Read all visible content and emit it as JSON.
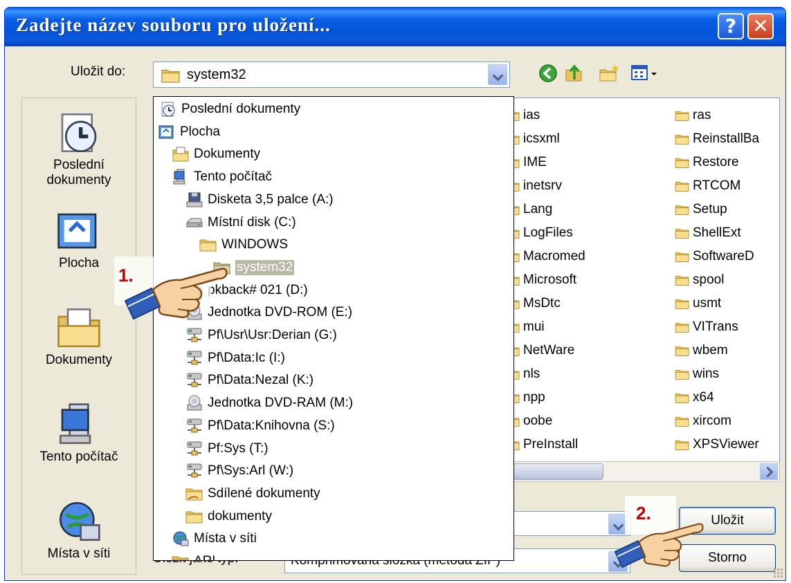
{
  "window": {
    "title": "Zadejte název souboru pro uložení...",
    "help_symbol": "?",
    "close_symbol": "✕"
  },
  "save_in": {
    "label": "Uložit do:",
    "value": "system32"
  },
  "toolbar": {
    "icons": [
      "back-icon",
      "up-folder-icon",
      "new-folder-icon",
      "views-menu-icon"
    ]
  },
  "places": [
    {
      "label": "Poslední\ndokumenty",
      "icon": "recent-documents-icon"
    },
    {
      "label": "Plocha",
      "icon": "desktop-icon"
    },
    {
      "label": "Dokumenty",
      "icon": "my-documents-icon"
    },
    {
      "label": "Tento počítač",
      "icon": "my-computer-icon"
    },
    {
      "label": "Místa v síti",
      "icon": "network-places-icon"
    }
  ],
  "dropdown_tree": [
    {
      "label": "Poslední dokumenty",
      "icon": "recent-documents-icon"
    },
    {
      "label": "Plocha",
      "icon": "desktop-icon"
    },
    {
      "label": "Dokumenty",
      "icon": "my-documents-icon"
    },
    {
      "label": "Tento počítač",
      "icon": "my-computer-icon"
    },
    {
      "label": "Disketa 3,5 palce (A:)",
      "icon": "floppy-drive-icon"
    },
    {
      "label": "Místní disk (C:)",
      "icon": "hard-drive-icon"
    },
    {
      "label": "WINDOWS",
      "icon": "folder-icon"
    },
    {
      "label": "system32",
      "icon": "folder-icon",
      "selected": true
    },
    {
      "label": "pkback# 021 (D:)",
      "icon": "hard-drive-icon"
    },
    {
      "label": "Jednotka DVD-ROM (E:)",
      "icon": "dvd-drive-icon"
    },
    {
      "label": "Pf\\Usr\\Usr:Derian (G:)",
      "icon": "network-drive-icon"
    },
    {
      "label": "Pf\\Data:Ic (I:)",
      "icon": "network-drive-icon"
    },
    {
      "label": "Pf\\Data:Nezal (K:)",
      "icon": "network-drive-icon"
    },
    {
      "label": "Jednotka DVD-RAM (M:)",
      "icon": "dvd-drive-icon"
    },
    {
      "label": "Pf\\Data:Knihovna (S:)",
      "icon": "network-drive-icon"
    },
    {
      "label": "Pf:Sys (T:)",
      "icon": "network-drive-icon"
    },
    {
      "label": "Pf\\Sys:Arl (W:)",
      "icon": "network-drive-icon"
    },
    {
      "label": "Sdílené dokumenty",
      "icon": "shared-folder-icon"
    },
    {
      "label": "dokumenty",
      "icon": "folder-icon"
    },
    {
      "label": "Místa v síti",
      "icon": "network-places-icon"
    },
    {
      "label": "ARL",
      "icon": "folder-icon"
    }
  ],
  "files": {
    "column1": [
      "ias",
      "icsxml",
      "IME",
      "inetsrv",
      "Lang",
      "LogFiles",
      "Macromed",
      "Microsoft",
      "MsDtc",
      "mui",
      "NetWare",
      "nls",
      "npp",
      "oobe",
      "PreInstall"
    ],
    "column2": [
      "ras",
      "ReinstallBa",
      "Restore",
      "RTCOM",
      "Setup",
      "ShellExt",
      "SoftwareD",
      "spool",
      "usmt",
      "VITrans",
      "wbem",
      "wins",
      "x64",
      "xircom",
      "XPSViewer"
    ]
  },
  "save_as_type": {
    "label": "Uložit jako typ:",
    "value": "Komprimovaná složka (metoda ZIP)"
  },
  "buttons": {
    "save": "Uložit",
    "cancel": "Storno"
  },
  "annotations": {
    "step1": "1.",
    "step2": "2."
  },
  "colors": {
    "title_bar": "#0a5fe6",
    "dialog_face": "#ece9d8",
    "folder_yellow": "#f5d677",
    "annotation_red": "#c00000"
  }
}
